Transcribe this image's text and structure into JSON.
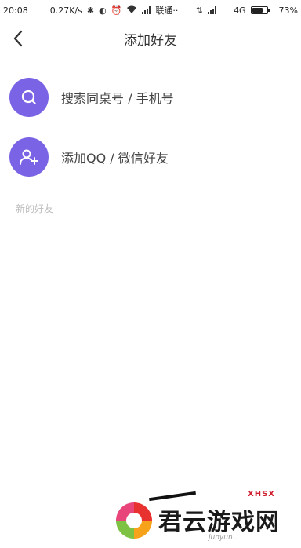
{
  "status_bar": {
    "time": "20:08",
    "speed": "0.27K/s",
    "carrier": "联通··",
    "network": "4G",
    "battery_text": "73%",
    "battery_level": 0.73
  },
  "nav": {
    "title": "添加好友"
  },
  "actions": [
    {
      "label": "搜索同桌号 / 手机号",
      "icon": "search-icon"
    },
    {
      "label": "添加QQ / 微信好友",
      "icon": "add-user-icon"
    }
  ],
  "section": {
    "new_friends": "新的好友"
  },
  "watermark": {
    "brand": "君云游戏网",
    "sub": "junyun...",
    "red_tag": "XHSX"
  },
  "colors": {
    "accent": "#7b63e6"
  }
}
